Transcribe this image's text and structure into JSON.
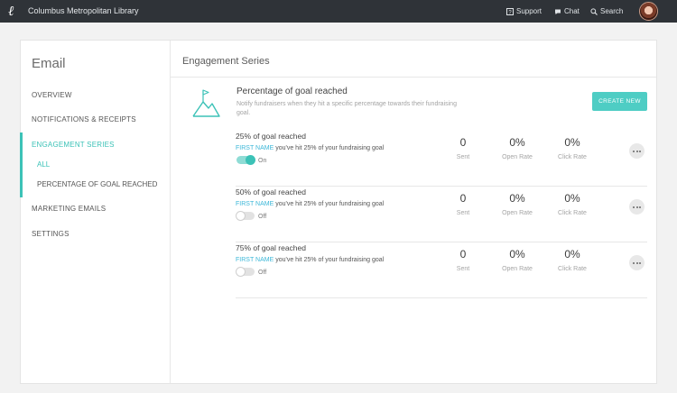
{
  "topbar": {
    "logo_glyph": "ℓ",
    "org_name": "Columbus Metropolitan Library",
    "support_label": "Support",
    "chat_label": "Chat",
    "search_label": "Search"
  },
  "sidebar": {
    "title": "Email",
    "items": [
      {
        "label": "OVERVIEW"
      },
      {
        "label": "NOTIFICATIONS & RECEIPTS"
      },
      {
        "label": "ENGAGEMENT SERIES"
      },
      {
        "label": "MARKETING EMAILS"
      },
      {
        "label": "SETTINGS"
      }
    ],
    "sub_items": [
      {
        "label": "ALL"
      },
      {
        "label": "PERCENTAGE OF GOAL REACHED"
      }
    ]
  },
  "main": {
    "title": "Engagement Series",
    "series": {
      "title": "Percentage of goal reached",
      "description": "Notify fundraisers when they hit a specific percentage towards their fundraising goal.",
      "create_label": "CREATE NEW"
    },
    "rows": [
      {
        "title": "25% of goal reached",
        "first_name": "FIRST NAME",
        "message": "you've hit 25% of your fundraising goal",
        "toggle_label": "On",
        "sent": "0",
        "sent_label": "Sent",
        "open_rate": "0%",
        "open_label": "Open Rate",
        "click_rate": "0%",
        "click_label": "Click Rate"
      },
      {
        "title": "50% of goal reached",
        "first_name": "FIRST NAME",
        "message": "you've hit 25% of your fundraising goal",
        "toggle_label": "Off",
        "sent": "0",
        "sent_label": "Sent",
        "open_rate": "0%",
        "open_label": "Open Rate",
        "click_rate": "0%",
        "click_label": "Click Rate"
      },
      {
        "title": "75% of goal reached",
        "first_name": "FIRST NAME",
        "message": "you've hit 25% of your fundraising goal",
        "toggle_label": "Off",
        "sent": "0",
        "sent_label": "Sent",
        "open_rate": "0%",
        "open_label": "Open Rate",
        "click_rate": "0%",
        "click_label": "Click Rate"
      }
    ]
  },
  "colors": {
    "accent": "#3cc2b7",
    "topbar": "#2f3338",
    "link": "#3cb7d8"
  }
}
